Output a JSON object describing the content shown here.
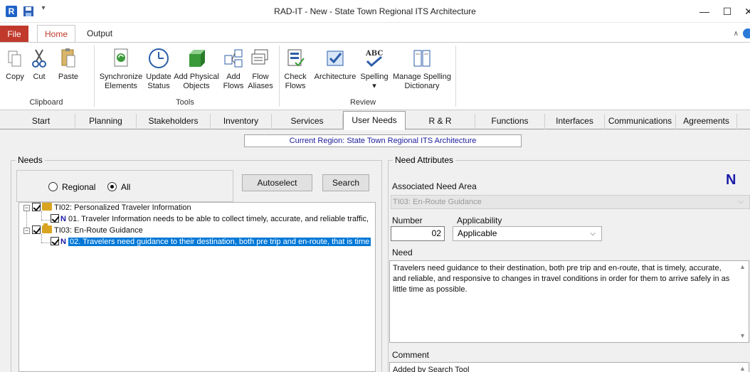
{
  "window": {
    "app_icon": "R",
    "title": "RAD-IT - New - State Town Regional ITS Architecture",
    "qa_dropdown": "▾",
    "minimize": "—",
    "maximize": "☐",
    "close": "✕"
  },
  "ribbon_tabs": {
    "file": "File",
    "home": "Home",
    "output": "Output",
    "collapse": "∧"
  },
  "ribbon": {
    "clipboard": {
      "copy": "Copy",
      "cut": "Cut",
      "paste": "Paste",
      "label": "Clipboard"
    },
    "tools": {
      "sync_1": "Synchronize",
      "sync_2": "Elements",
      "update_1": "Update",
      "update_2": "Status",
      "addphys_1": "Add Physical",
      "addphys_2": "Objects",
      "addflows_1": "Add",
      "addflows_2": "Flows",
      "flowalias_1": "Flow",
      "flowalias_2": "Aliases",
      "label": "Tools"
    },
    "review": {
      "checkflows_1": "Check",
      "checkflows_2": "Flows",
      "architecture": "Architecture",
      "spelling": "Spelling",
      "spelling_glyph": "ABC",
      "spelling_dropdown": "▾",
      "manage_1": "Manage Spelling",
      "manage_2": "Dictionary",
      "label": "Review"
    }
  },
  "tabs": [
    "Start",
    "Planning",
    "Stakeholders",
    "Inventory",
    "Services",
    "User Needs",
    "R & R",
    "Functions",
    "Interfaces",
    "Communications",
    "Agreements"
  ],
  "region_banner": "Current Region: State Town Regional ITS Architecture",
  "needs": {
    "title": "Needs",
    "radio_regional": "Regional",
    "radio_all": "All",
    "selected_filter": "All",
    "autoselect": "Autoselect",
    "search": "Search",
    "tree": [
      {
        "label": "TI02: Personalized Traveler Information",
        "children": [
          {
            "mark": "N",
            "label": "01. Traveler Information needs to be able to collect timely, accurate, and reliable traffic,"
          }
        ]
      },
      {
        "label": "TI03: En-Route Guidance",
        "children": [
          {
            "mark": "N",
            "label": "02. Travelers need guidance to their destination, both pre trip and en-route,  that is time",
            "selected": true
          }
        ]
      }
    ]
  },
  "attributes": {
    "title": "Need Attributes",
    "indicator": "N",
    "need_area_label": "Associated Need Area",
    "need_area_value": "TI03: En-Route Guidance",
    "number_label": "Number",
    "number_value": "02",
    "applicability_label": "Applicability",
    "applicability_value": "Applicable",
    "need_label": "Need",
    "need_text": "Travelers need guidance to their destination, both pre trip and en-route,  that is timely, accurate, and reliable, and responsive to changes in travel conditions in order for them to arrive safely in as little time as possible.",
    "comment_label": "Comment",
    "comment_text": "Added by Search Tool"
  },
  "colors": {
    "file_tab": "#c0392b",
    "selection": "#0078d7",
    "need_mark": "#1a1aa8",
    "region_text": "#1a1a9a"
  }
}
